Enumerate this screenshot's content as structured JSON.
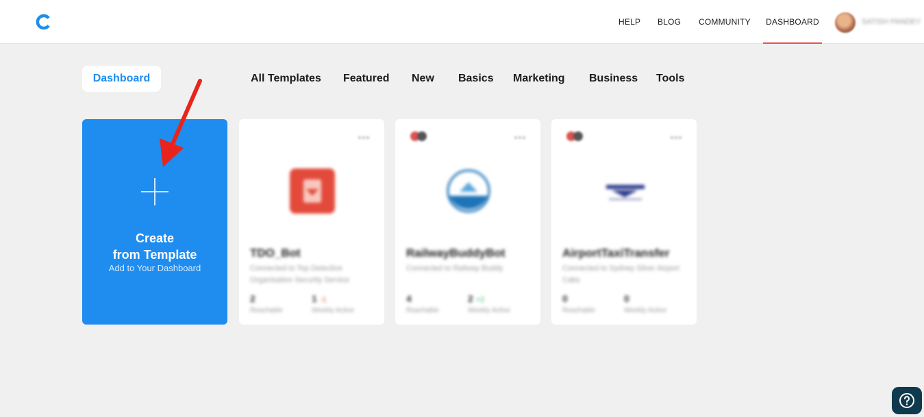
{
  "header": {
    "logo_icon": "logo-c-icon",
    "nav": {
      "help": "HELP",
      "blog": "BLOG",
      "community": "COMMUNITY",
      "dashboard": "DASHBOARD"
    },
    "active_accent": "#e8524a",
    "username": "SATISH PANDEY"
  },
  "tabs": {
    "dashboard": "Dashboard",
    "all_templates": "All Templates",
    "featured": "Featured",
    "new": "New",
    "basics": "Basics",
    "marketing": "Marketing",
    "business": "Business",
    "tools": "Tools"
  },
  "create_card": {
    "title_line1": "Create",
    "title_line2": "from Template",
    "subtitle": "Add to Your Dashboard",
    "color": "#1f8def",
    "icon": "plus-icon"
  },
  "bots": [
    {
      "name": "TDO_Bot",
      "desc": "Connected to Top Detective Organisation Security Service",
      "reachable_value": "2",
      "reachable_label": "Reachable",
      "weekly_value": "1",
      "weekly_delta": "-1",
      "weekly_label": "Weekly Active"
    },
    {
      "name": "RailwayBuddyBot",
      "desc": "Connected to Railway Buddy",
      "reachable_value": "4",
      "reachable_label": "Reachable",
      "weekly_value": "2",
      "weekly_delta": "+2",
      "weekly_label": "Weekly Active"
    },
    {
      "name": "AirportTaxiTransfer",
      "desc": "Connected to Sydney Silver Airport Cabs",
      "reachable_value": "0",
      "reachable_label": "Reachable",
      "weekly_value": "0",
      "weekly_delta": "",
      "weekly_label": "Weekly Active"
    }
  ],
  "help_button": {
    "icon": "question-icon",
    "color": "#0f3a4d"
  },
  "annotation": {
    "arrow_color": "#e8241c"
  }
}
